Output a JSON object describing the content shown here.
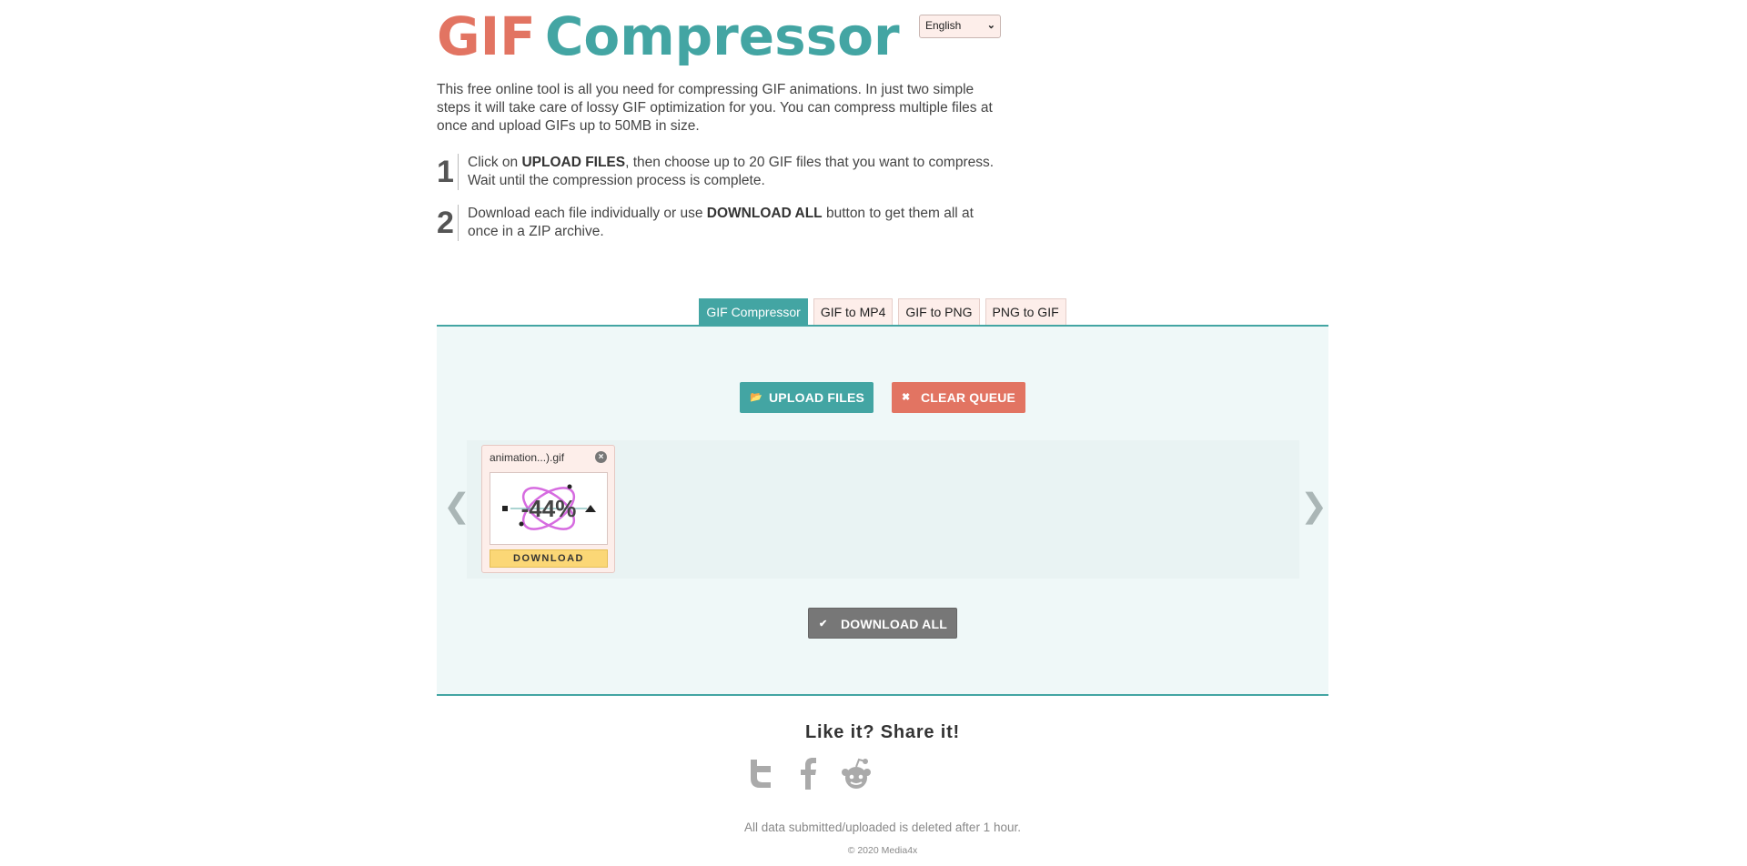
{
  "header": {
    "logo_gif": "GIF",
    "logo_rest": "Compressor",
    "language": "English"
  },
  "intro": "This free online tool is all you need for compressing GIF animations. In just two simple steps it will take care of lossy GIF optimization for you. You can compress multiple files at once and upload GIFs up to 50MB in size.",
  "steps": [
    {
      "num": "1",
      "pre": "Click on ",
      "bold": "UPLOAD FILES",
      "post": ", then choose up to 20 GIF files that you want to compress. Wait until the compression process is complete."
    },
    {
      "num": "2",
      "pre": "Download each file individually or use ",
      "bold": "DOWNLOAD ALL",
      "post": " button to get them all at once in a ZIP archive."
    }
  ],
  "tabs": [
    "GIF Compressor",
    "GIF to MP4",
    "GIF to PNG",
    "PNG to GIF"
  ],
  "buttons": {
    "upload": "UPLOAD FILES",
    "clear": "CLEAR QUEUE",
    "download_all": "DOWNLOAD ALL"
  },
  "queue": {
    "files": [
      {
        "name": "animation...).gif",
        "reduction": "-44%",
        "download": "DOWNLOAD"
      }
    ]
  },
  "footer": {
    "share": "Like it? Share it!",
    "note": "All data submitted/uploaded is deleted after 1 hour.",
    "copyright": "© 2020 Media4x"
  },
  "colors": {
    "accent_teal": "#43a5a3",
    "accent_coral": "#e27462",
    "download_yellow": "#fbd776"
  }
}
